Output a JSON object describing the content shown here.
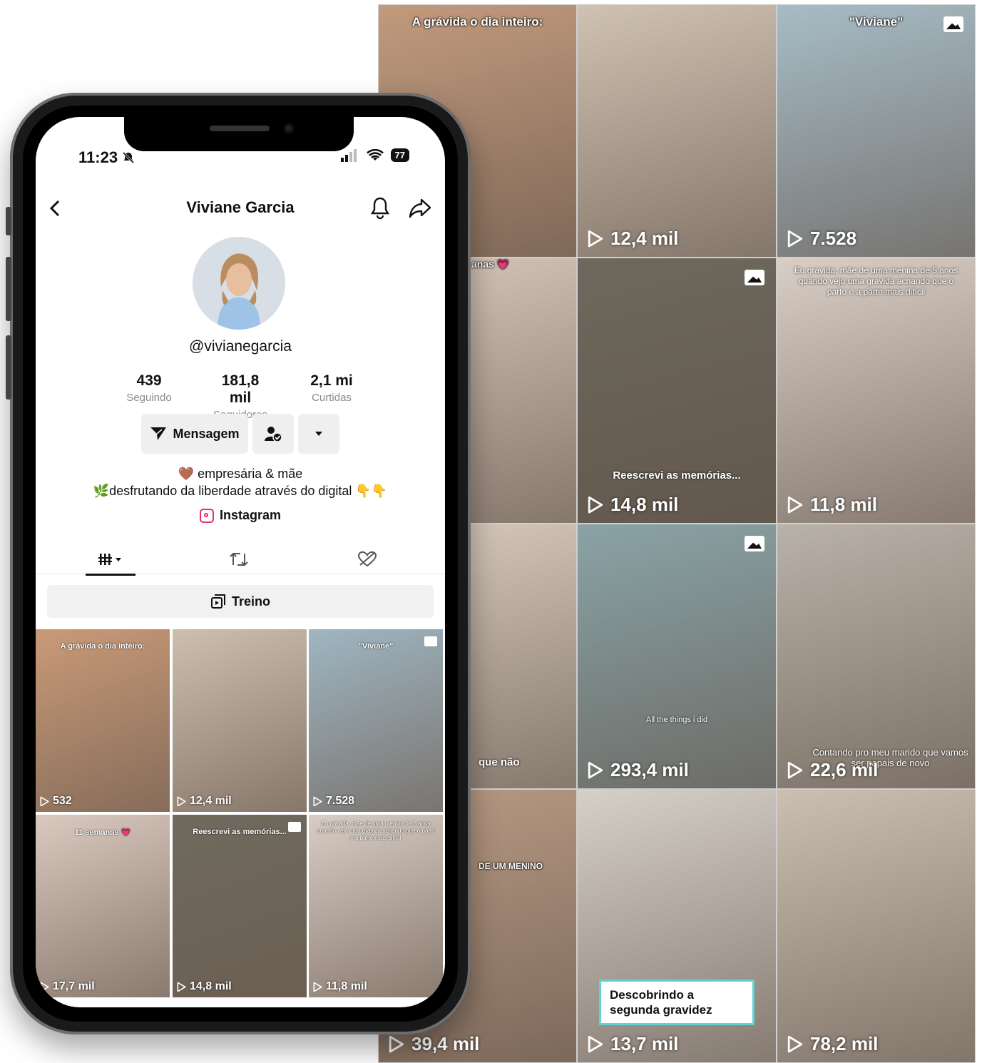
{
  "phone": {
    "status_time": "11:23",
    "battery": "77",
    "profile_name": "Viviane Garcia",
    "username": "@vivianegarcia",
    "stats": [
      {
        "value": "439",
        "label": "Seguindo"
      },
      {
        "value": "181,8 mil",
        "label": "Seguidores"
      },
      {
        "value": "2,1 mi",
        "label": "Curtidas"
      }
    ],
    "buttons": {
      "message": "Mensagem"
    },
    "bio_line1": "🤎 empresária & mãe",
    "bio_line2": "🌿desfrutando da liberdade através do digital 👇👇",
    "instagram_link": "Instagram",
    "playlist_label": "Treino",
    "grid": [
      {
        "views": "532",
        "caption": "A grávida o dia inteiro:",
        "color": "#c99a78"
      },
      {
        "views": "12,4 mil",
        "caption": "",
        "color": "#cdbfae"
      },
      {
        "views": "7.528",
        "caption": "\"Viviane\"",
        "color": "#9fb6c2"
      },
      {
        "views": "17,7 mil",
        "caption": "11 semanas 💗",
        "color": "#d9c9bf"
      },
      {
        "views": "14,8 mil",
        "caption": "Reescrevi as memórias...",
        "color": "#6f6a5f"
      },
      {
        "views": "11,8 mil",
        "caption": "Eu grávida, mãe de uma menina de 5 anos quando vejo uma grávida achando que o parto é a parte mais difícil",
        "color": "#d8cdc4"
      }
    ]
  },
  "background_grid": [
    {
      "views": "",
      "caption": "A grávida o dia inteiro:",
      "color": "#c29a7d"
    },
    {
      "views": "12,4 mil",
      "caption": "",
      "color": "#cfc2b2"
    },
    {
      "views": "7.528",
      "caption": "\"Viviane\"",
      "color": "#a7bcc6"
    },
    {
      "views": "",
      "caption": "anas 💗",
      "color": "#d7c6ba"
    },
    {
      "views": "14,8 mil",
      "caption": "Reescrevi as memórias...",
      "color": "#6d685d"
    },
    {
      "views": "11,8 mil",
      "caption": "Eu grávida, mãe de uma menina de 5 anos quando vejo uma grávida achando que o parto é a parte mais difícil",
      "color": "#d9cec5"
    },
    {
      "views": "",
      "caption": "que não",
      "color": "#d8cbbd"
    },
    {
      "views": "293,4 mil",
      "caption": "All the things i did",
      "color": "#8aa3a6"
    },
    {
      "views": "22,6 mil",
      "caption": "Contando pro meu marido que vamos ser papais de novo",
      "color": "#b9b2a8"
    },
    {
      "views": "39,4 mil",
      "caption": "DE UM MENINO",
      "color": "#b89a84"
    },
    {
      "views": "13,7 mil",
      "caption": "Descobrindo a segunda gravidez",
      "color": "#d6d0c8"
    },
    {
      "views": "78,2 mil",
      "caption": "",
      "color": "#cbbfb1"
    }
  ]
}
